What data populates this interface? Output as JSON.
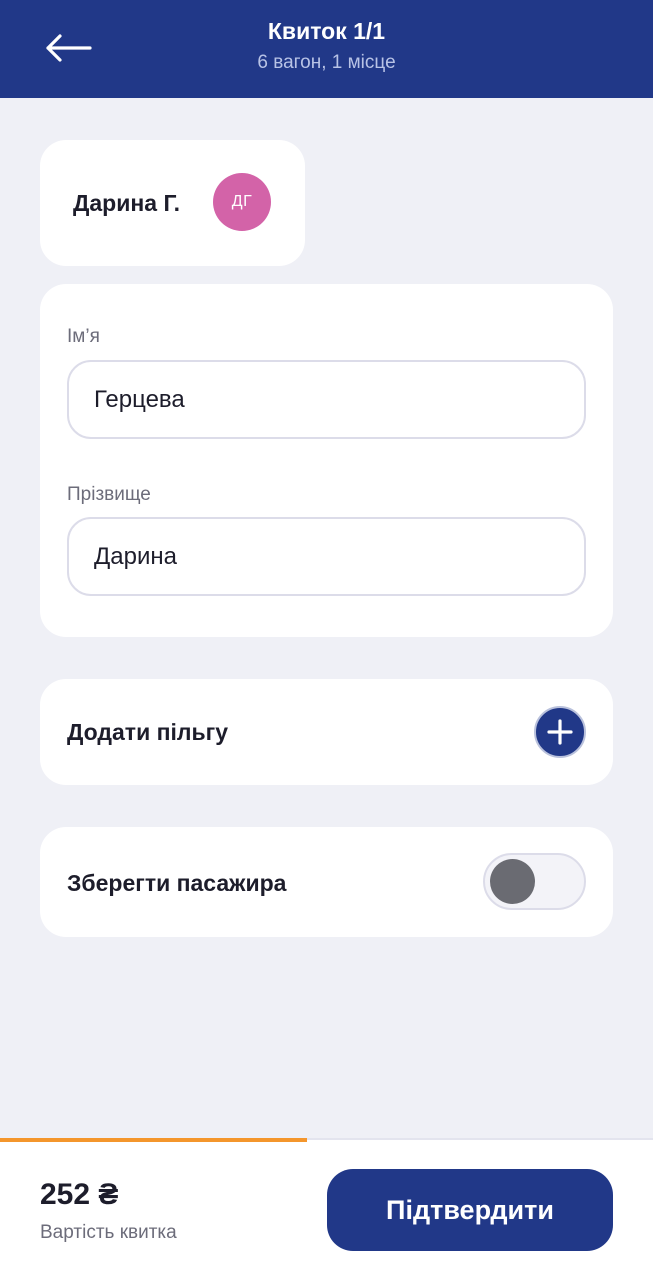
{
  "header": {
    "title": "Квиток 1/1",
    "subtitle": "6 вагон, 1 місце",
    "back_icon": "arrow-left-icon"
  },
  "passenger": {
    "short_name": "Дарина Г.",
    "initials": "ДГ",
    "avatar_color": "#d363a8"
  },
  "form": {
    "first_name_label": "Ім’я",
    "first_name_value": "Герцева",
    "last_name_label": "Прізвище",
    "last_name_value": "Дарина"
  },
  "benefit": {
    "label": "Додати пільгу",
    "icon": "plus-icon"
  },
  "save_passenger": {
    "label": "Зберегти пасажира",
    "enabled": false
  },
  "footer": {
    "price": "252 ₴",
    "price_caption": "Вартість квитка",
    "confirm_label": "Підтвердити",
    "progress": 0.47
  },
  "colors": {
    "brand": "#213888",
    "accent": "#f4962c",
    "background": "#eff0f6"
  }
}
